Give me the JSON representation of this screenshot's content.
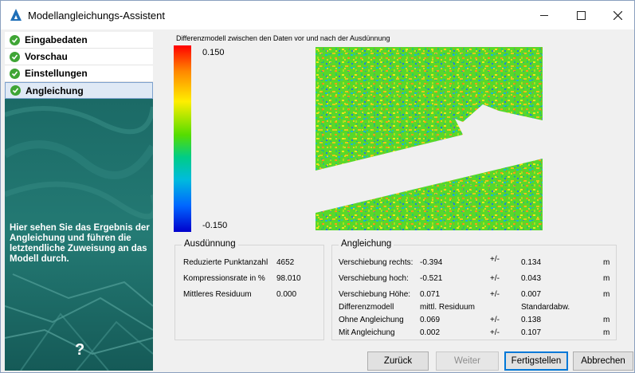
{
  "window": {
    "title": "Modellangleichungs-Assistent"
  },
  "steps": [
    {
      "label": "Eingabedaten",
      "done": true
    },
    {
      "label": "Vorschau",
      "done": true
    },
    {
      "label": "Einstellungen",
      "done": true
    },
    {
      "label": "Angleichung",
      "done": true,
      "active": true
    }
  ],
  "sidebar": {
    "help_text": "Hier sehen Sie das Ergebnis der Angleichung und führen die letztendliche Zuweisung an das Modell durch.",
    "help_symbol": "?"
  },
  "preview": {
    "title": "Differenzmodell zwischen den Daten vor und nach der Ausdünnung",
    "legend_max": "0.150",
    "legend_min": "-0.150"
  },
  "ausduennung": {
    "title": "Ausdünnung",
    "rows": [
      {
        "label": "Reduzierte Punktanzahl",
        "value": "4652"
      },
      {
        "label": "Kompressionsrate in %",
        "value": "98.010"
      },
      {
        "label": "Mittleres Residuum",
        "value": "0.000"
      }
    ]
  },
  "angleichung": {
    "title": "Angleichung",
    "pm": "+/-",
    "unit": "m",
    "shift_rows": [
      {
        "label": "Verschiebung rechts:",
        "value": "-0.394",
        "err": "0.134"
      },
      {
        "label": "Verschiebung hoch:",
        "value": "-0.521",
        "err": "0.043"
      },
      {
        "label": "Verschiebung Höhe:",
        "value": "0.071",
        "err": "0.007"
      }
    ],
    "header": {
      "label": "Differenzmodell",
      "col1": "mittl. Residuum",
      "col2": "Standardabw."
    },
    "model_rows": [
      {
        "label": "Ohne Angleichung",
        "value": "0.069",
        "err": "0.138"
      },
      {
        "label": "Mit Angleichung",
        "value": "0.002",
        "err": "0.107"
      }
    ]
  },
  "buttons": {
    "back": "Zurück",
    "next": "Weiter",
    "finish": "Fertigstellen",
    "cancel": "Abbrechen"
  }
}
